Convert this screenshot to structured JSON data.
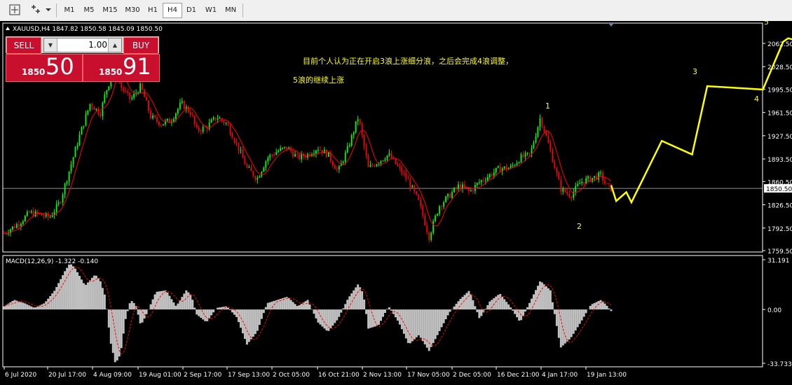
{
  "toolbar": {
    "icons": [
      "crosshair-icon",
      "objects-icon"
    ],
    "timeframes": [
      "M1",
      "M5",
      "M15",
      "M30",
      "H1",
      "H4",
      "D1",
      "W1",
      "MN"
    ],
    "active_timeframe": "H4"
  },
  "header": {
    "symbol_info": "XAUUSD,H4  1847.82 1850.58 1845.09 1850.50"
  },
  "trade_panel": {
    "sell_label": "SELL",
    "buy_label": "BUY",
    "lot_value": "1.00",
    "sell_small": "1850",
    "sell_big": "50",
    "buy_small": "1850",
    "buy_big": "91"
  },
  "annotations": {
    "text_line1": "目前个人认为正在开启3浪上涨细分浪，之后会完成4浪调整，",
    "text_line2": "5浪的继续上涨",
    "wave_labels": [
      "1",
      "2",
      "3",
      "4",
      "5"
    ]
  },
  "colors": {
    "bull_candle": "#00ff00",
    "bear_candle": "#ff0000",
    "ma_line": "#ff0000",
    "projection": "#ffff00",
    "macd_hist": "#c0c0c0",
    "macd_signal": "#ff0000",
    "text_yellow": "#ffff00"
  },
  "chart_data": {
    "type": "candlestick",
    "symbol": "XAUUSD",
    "timeframe": "H4",
    "current_price": 1850.5,
    "price_ticks": [
      "2062.50",
      "2028.50",
      "1995.50",
      "1961.50",
      "1927.50",
      "1893.50",
      "1860.50",
      "1850.50",
      "1826.50",
      "1792.50",
      "1759.50"
    ],
    "price_range": [
      1759.5,
      2062.5
    ],
    "date_ticks": [
      "6 Jul 2020",
      "20 Jul 17:00",
      "4 Aug 09:00",
      "19 Aug 01:00",
      "2 Sep 17:00",
      "17 Sep 13:00",
      "2 Oct 05:00",
      "16 Oct 21:00",
      "2 Nov 13:00",
      "17 Nov 05:00",
      "2 Dec 05:00",
      "16 Dec 21:00",
      "4 Jan 17:00",
      "19 Jan 13:00"
    ],
    "close_path": [
      [
        0,
        1785
      ],
      [
        3,
        1800
      ],
      [
        5,
        1815
      ],
      [
        7,
        1812
      ],
      [
        9,
        1808
      ],
      [
        11,
        1830
      ],
      [
        13,
        1880
      ],
      [
        15,
        1930
      ],
      [
        17,
        1975
      ],
      [
        19,
        1960
      ],
      [
        20,
        1990
      ],
      [
        22,
        2030
      ],
      [
        23,
        2000
      ],
      [
        25,
        1980
      ],
      [
        27,
        2000
      ],
      [
        29,
        1955
      ],
      [
        31,
        1945
      ],
      [
        33,
        1950
      ],
      [
        35,
        1975
      ],
      [
        37,
        1960
      ],
      [
        38,
        1935
      ],
      [
        40,
        1940
      ],
      [
        42,
        1955
      ],
      [
        44,
        1945
      ],
      [
        46,
        1915
      ],
      [
        48,
        1880
      ],
      [
        50,
        1865
      ],
      [
        52,
        1895
      ],
      [
        54,
        1905
      ],
      [
        56,
        1910
      ],
      [
        58,
        1895
      ],
      [
        60,
        1900
      ],
      [
        62,
        1910
      ],
      [
        64,
        1900
      ],
      [
        66,
        1875
      ],
      [
        68,
        1910
      ],
      [
        70,
        1955
      ],
      [
        72,
        1880
      ],
      [
        74,
        1890
      ],
      [
        76,
        1900
      ],
      [
        78,
        1880
      ],
      [
        80,
        1860
      ],
      [
        82,
        1830
      ],
      [
        84,
        1780
      ],
      [
        86,
        1825
      ],
      [
        88,
        1840
      ],
      [
        90,
        1855
      ],
      [
        92,
        1845
      ],
      [
        94,
        1860
      ],
      [
        96,
        1870
      ],
      [
        98,
        1880
      ],
      [
        100,
        1880
      ],
      [
        102,
        1895
      ],
      [
        104,
        1900
      ],
      [
        106,
        1955
      ],
      [
        108,
        1905
      ],
      [
        110,
        1850
      ],
      [
        112,
        1840
      ],
      [
        114,
        1860
      ],
      [
        116,
        1865
      ],
      [
        118,
        1870
      ],
      [
        119,
        1855
      ],
      [
        120,
        1850.5
      ]
    ],
    "x_range": [
      0,
      120
    ],
    "projection": {
      "name": "wave projection",
      "points": [
        [
          120,
          1855
        ],
        [
          121,
          1832
        ],
        [
          123,
          1845
        ],
        [
          124,
          1830
        ],
        [
          130,
          1920
        ],
        [
          136,
          1900
        ],
        [
          139,
          2000
        ],
        [
          150,
          1995
        ],
        [
          154,
          2065
        ],
        [
          155,
          2070
        ],
        [
          156,
          2068
        ]
      ]
    },
    "macd": {
      "label": "MACD(12,26,9) -1.322 -0.140",
      "ticks": [
        "31.191",
        "0.00",
        "-33.733"
      ],
      "range": [
        -33.733,
        31.191
      ],
      "histogram": [
        [
          0,
          2
        ],
        [
          2,
          6
        ],
        [
          4,
          4
        ],
        [
          6,
          1
        ],
        [
          8,
          4
        ],
        [
          10,
          12
        ],
        [
          12,
          24
        ],
        [
          13,
          29
        ],
        [
          14,
          26
        ],
        [
          16,
          15
        ],
        [
          18,
          22
        ],
        [
          19,
          18
        ],
        [
          20,
          8
        ],
        [
          21,
          -20
        ],
        [
          22,
          -34
        ],
        [
          23,
          -28
        ],
        [
          24,
          -6
        ],
        [
          25,
          6
        ],
        [
          26,
          3
        ],
        [
          27,
          -10
        ],
        [
          28,
          -4
        ],
        [
          30,
          11
        ],
        [
          32,
          12
        ],
        [
          34,
          2
        ],
        [
          36,
          12
        ],
        [
          37,
          9
        ],
        [
          38,
          -3
        ],
        [
          40,
          -8
        ],
        [
          42,
          1
        ],
        [
          44,
          2
        ],
        [
          46,
          -5
        ],
        [
          48,
          -22
        ],
        [
          50,
          -14
        ],
        [
          52,
          4
        ],
        [
          54,
          6
        ],
        [
          56,
          8
        ],
        [
          58,
          2
        ],
        [
          60,
          6
        ],
        [
          62,
          -8
        ],
        [
          64,
          -14
        ],
        [
          66,
          -6
        ],
        [
          68,
          7
        ],
        [
          70,
          16
        ],
        [
          71,
          10
        ],
        [
          72,
          -12
        ],
        [
          74,
          -10
        ],
        [
          76,
          2
        ],
        [
          78,
          -8
        ],
        [
          80,
          -22
        ],
        [
          82,
          -16
        ],
        [
          84,
          -26
        ],
        [
          86,
          -14
        ],
        [
          88,
          -2
        ],
        [
          90,
          6
        ],
        [
          92,
          12
        ],
        [
          94,
          -6
        ],
        [
          96,
          5
        ],
        [
          98,
          10
        ],
        [
          100,
          2
        ],
        [
          102,
          -8
        ],
        [
          104,
          5
        ],
        [
          106,
          18
        ],
        [
          108,
          12
        ],
        [
          110,
          -24
        ],
        [
          112,
          -18
        ],
        [
          114,
          -8
        ],
        [
          116,
          3
        ],
        [
          118,
          6
        ],
        [
          119,
          3
        ],
        [
          120,
          -1
        ]
      ]
    }
  }
}
